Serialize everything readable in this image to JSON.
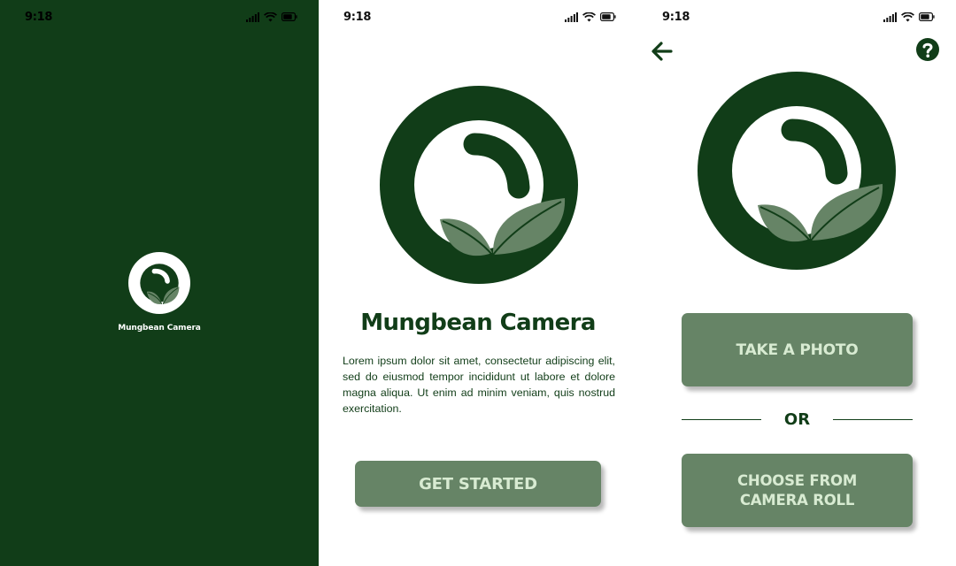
{
  "colors": {
    "brand_dark_green": "#113d18",
    "button_green": "#668466",
    "button_text": "#d8ebd2",
    "leaf_green": "#668466"
  },
  "status_bar": {
    "time": "9:18",
    "icons": [
      "signal-icon",
      "wifi-icon",
      "battery-icon"
    ]
  },
  "splash": {
    "app_name": "Mungbean Camera"
  },
  "welcome": {
    "title": "Mungbean Camera",
    "body": "Lorem ipsum dolor sit amet, consectetur adipiscing elit, sed do eiusmod tempor incididunt ut labore et dolore magna aliqua. Ut enim ad minim veniam, quis nostrud exercitation.",
    "get_started_label": "GET STARTED"
  },
  "camera_options": {
    "back_icon": "arrow-left-icon",
    "help_icon": "question-circle-icon",
    "take_photo_label": "TAKE A PHOTO",
    "or_label": "OR",
    "choose_line1": "CHOOSE FROM",
    "choose_line2": "CAMERA ROLL"
  }
}
